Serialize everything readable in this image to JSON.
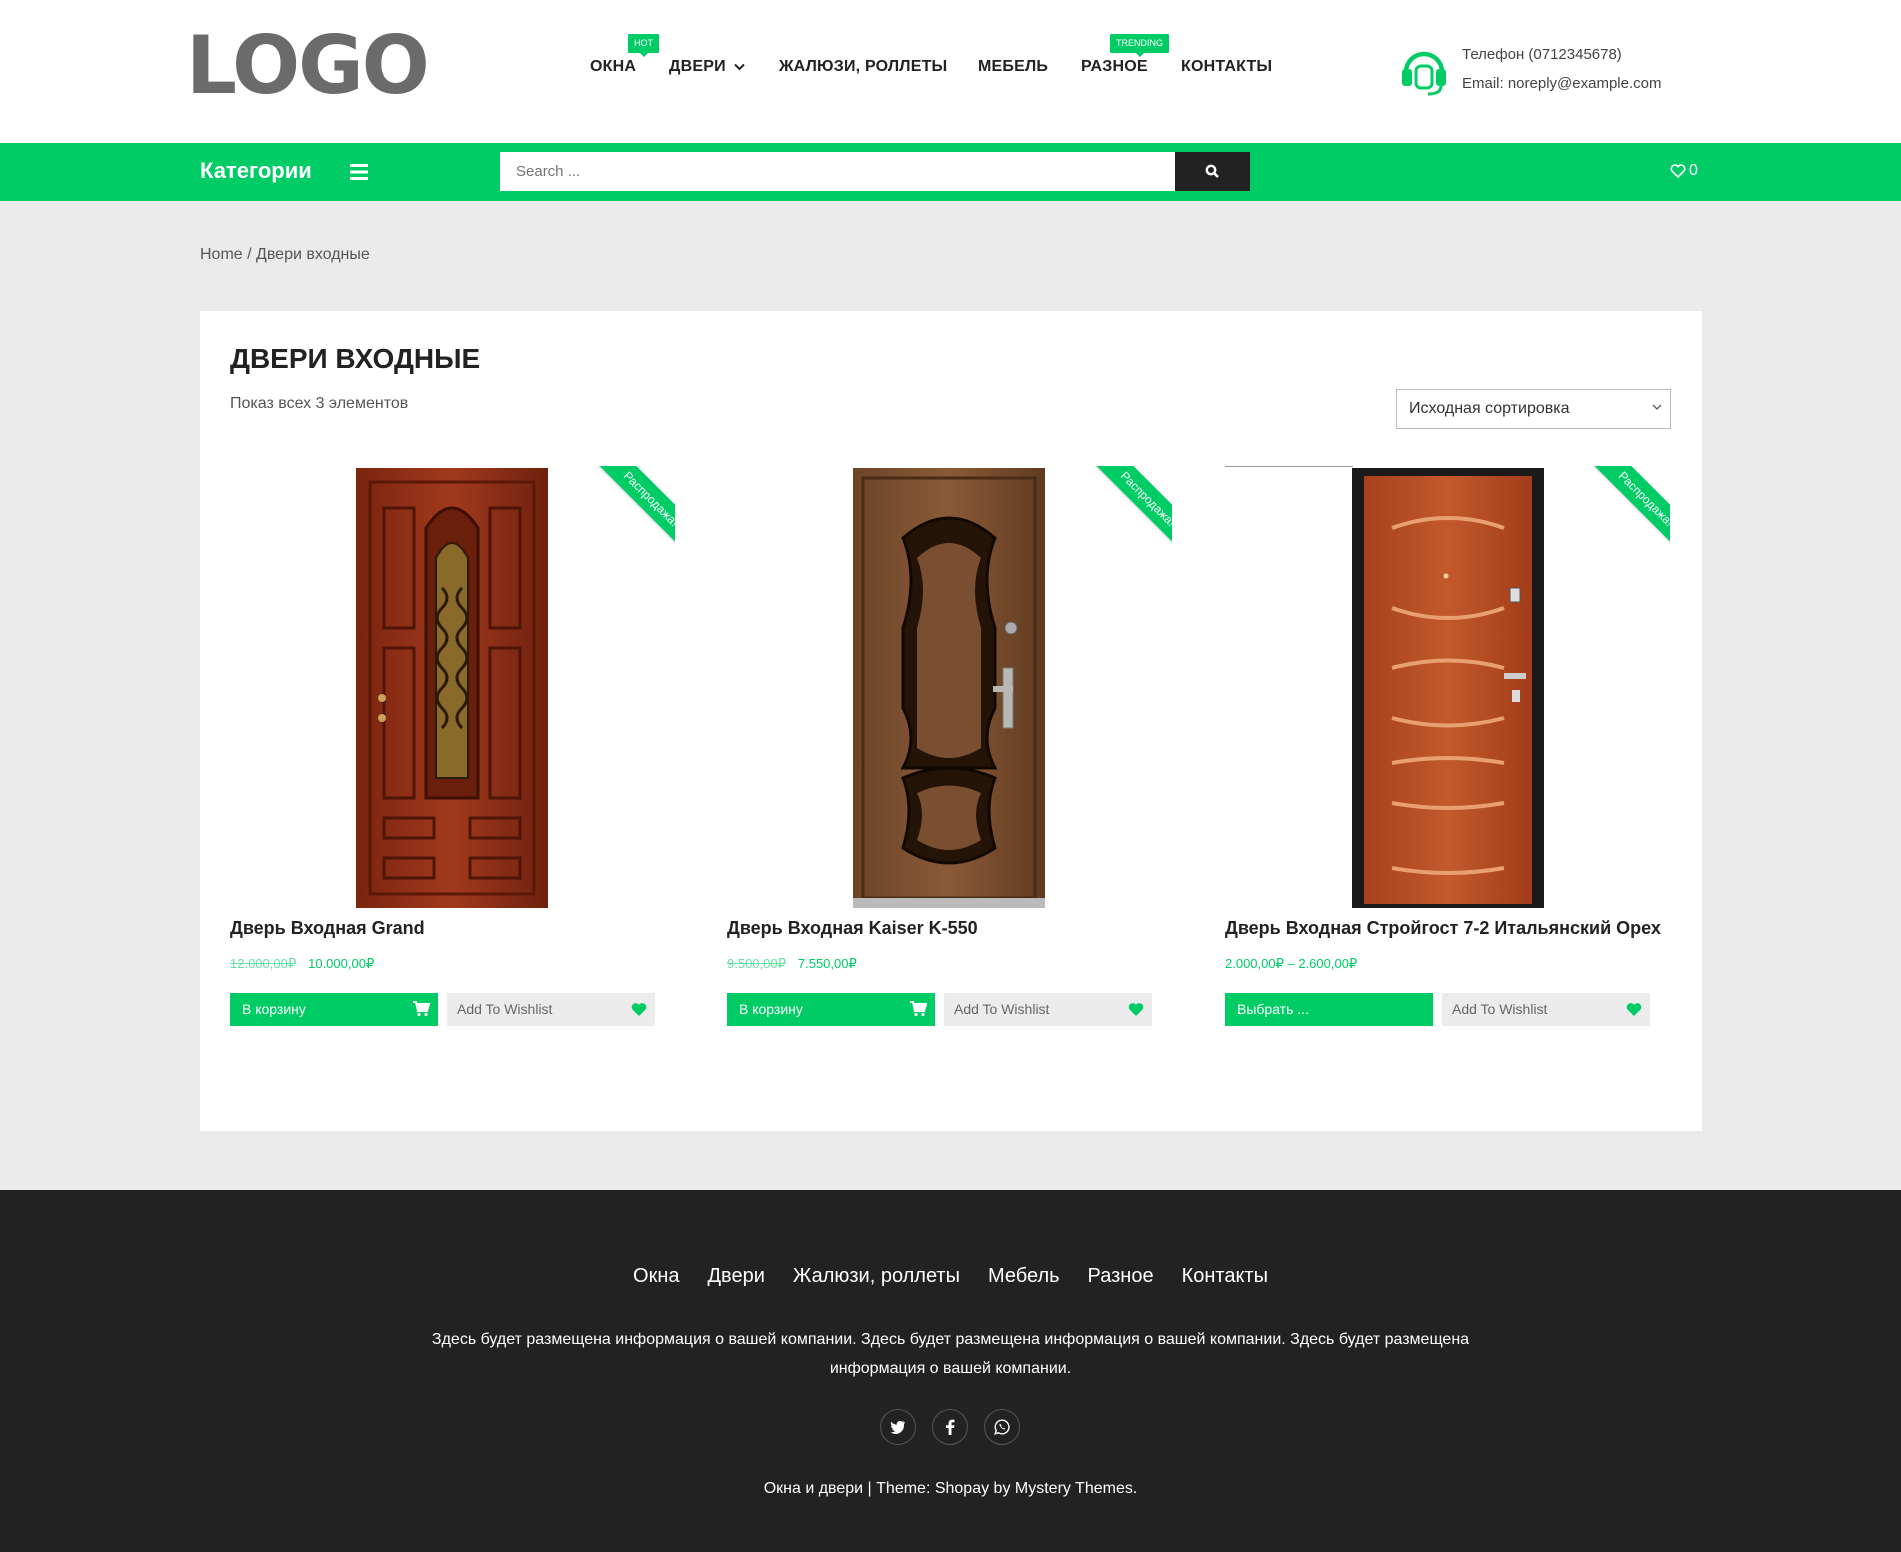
{
  "header": {
    "logo": "LOGO",
    "nav": [
      {
        "label": "ОКНА",
        "badge": "HOT"
      },
      {
        "label": "ДВЕРИ"
      },
      {
        "label": "ЖАЛЮЗИ, РОЛЛЕТЫ"
      },
      {
        "label": "МЕБЕЛЬ"
      },
      {
        "label": "РАЗНОЕ",
        "badge": "TRENDING"
      },
      {
        "label": "КОНТАКТЫ"
      }
    ],
    "contact": {
      "phone": "Телефон (0712345678)",
      "email": "Email: noreply@example.com"
    }
  },
  "toolbar": {
    "categories_label": "Категории",
    "search_placeholder": "Search ...",
    "wishlist_count": "0"
  },
  "breadcrumb": "Home / Двери входные",
  "main": {
    "title": "ДВЕРИ ВХОДНЫЕ",
    "result_count": "Показ всех 3 элементов",
    "sort_selected": "Исходная сортировка",
    "products": [
      {
        "name": "Дверь Входная Grand",
        "old_price": "12.000,00₽",
        "price": "10.000,00₽",
        "badge": "Распродажа!",
        "cart_label": "В корзину",
        "wishlist_label": "Add To Wishlist"
      },
      {
        "name": "Дверь Входная Kaiser K-550",
        "old_price": "9.500,00₽",
        "price": "7.550,00₽",
        "badge": "Распродажа!",
        "cart_label": "В корзину",
        "wishlist_label": "Add To Wishlist"
      },
      {
        "name": "Дверь Входная Стройгост 7-2 Итальянский Орех",
        "old_price": "",
        "price": "2.000,00₽ – 2.600,00₽",
        "badge": "Распродажа!",
        "cart_label": "Выбрать ...",
        "wishlist_label": "Add To Wishlist"
      }
    ]
  },
  "footer": {
    "nav": [
      "Окна",
      "Двери",
      "Жалюзи, роллеты",
      "Мебель",
      "Разное",
      "Контакты"
    ],
    "info": "Здесь будет размещена информация о вашей компании. Здесь будет размещена информация о вашей компании. Здесь будет размещена информация о вашей компании.",
    "socials": [
      "twitter-icon",
      "facebook-icon",
      "whatsapp-icon"
    ],
    "copyright": "Окна и двери | Theme: Shopay by Mystery Themes."
  },
  "colors": {
    "accent": "#00cc66",
    "dark": "#222222"
  }
}
